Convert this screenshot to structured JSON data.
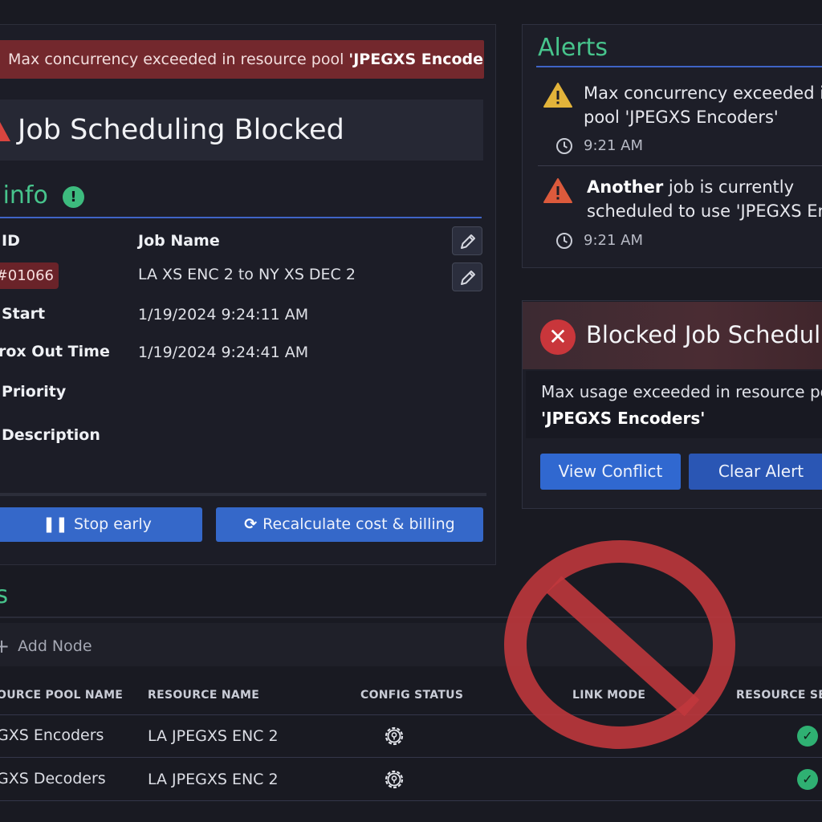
{
  "banner": {
    "prefix": "Max concurrency exceeded in resource pool ",
    "pool": "'JPEGXS Encoders'"
  },
  "page": {
    "title": "Job Scheduling Blocked"
  },
  "job_info": {
    "heading": "b info",
    "fields": {
      "id_label": "ID",
      "job_name_label": "Job Name",
      "id_value": "#01066",
      "job_name_value": "LA XS ENC 2 to NY XS DEC 2",
      "start_label": "Start",
      "start_value": "1/19/2024 9:24:11 AM",
      "out_label": "rox Out Time",
      "out_value": "1/19/2024 9:24:41 AM",
      "priority_label": "Priority",
      "description_label": "Description"
    },
    "buttons": {
      "stop_early": "Stop early",
      "recalculate": "Recalculate cost & billing"
    }
  },
  "nodes": {
    "heading": "des",
    "add_node": "Add Node",
    "columns": [
      "OURCE POOL NAME",
      "RESOURCE NAME",
      "CONFIG STATUS",
      "LINK MODE",
      "RESOURCE SELE"
    ],
    "rows": [
      {
        "pool": "GXS Encoders",
        "resource": "LA JPEGXS ENC 2"
      },
      {
        "pool": "GXS Decoders",
        "resource": "LA JPEGXS ENC 2"
      }
    ]
  },
  "alerts": {
    "title": "Alerts",
    "items": [
      {
        "line1": "Max concurrency exceeded in",
        "line2": "pool 'JPEGXS Encoders'",
        "time": "9:21 AM"
      },
      {
        "line1_bold": "Another",
        "line1_rest": " job is currently",
        "line2": "scheduled to use 'JPEGXS Enco",
        "time": "9:21 AM"
      }
    ]
  },
  "blocked_card": {
    "title": "Blocked Job Schedulin",
    "body_line1": "Max usage exceeded in resource poo",
    "body_line2": "'JPEGXS Encoders'",
    "view_conflict": "View Conflict",
    "clear_alert": "Clear Alert"
  },
  "colors": {
    "accent_green": "#47c48c",
    "primary_blue": "#3568c9",
    "danger_red": "#c9363b",
    "banner_red": "#73282d"
  }
}
